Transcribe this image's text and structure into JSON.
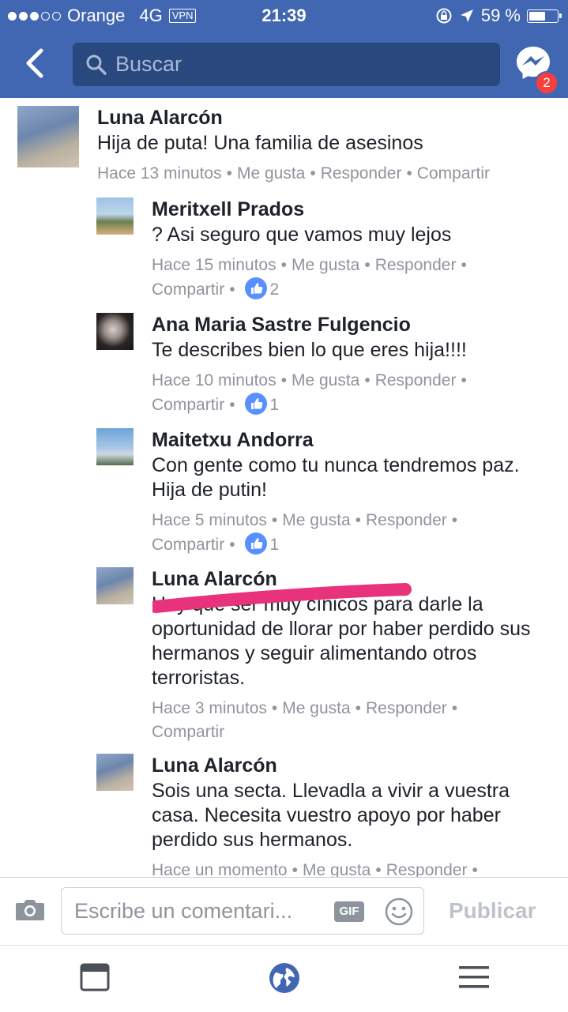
{
  "status_bar": {
    "carrier": "Orange",
    "network": "4G",
    "vpn": "VPN",
    "time": "21:39",
    "battery": "59 %",
    "battery_level": 0.59
  },
  "header": {
    "search_placeholder": "Buscar",
    "messenger_badge": "2"
  },
  "comments": [
    {
      "name": "Luna Alarcón",
      "text": "Hija de puta! Una familia de asesinos",
      "time": "Hace 13 minutos",
      "like": "Me gusta",
      "reply": "Responder",
      "share": "Compartir"
    },
    {
      "name": "Meritxell Prados",
      "text": "? Asi seguro que vamos muy lejos",
      "time": "Hace 15 minutos",
      "like": "Me gusta",
      "reply": "Responder",
      "share": "Compartir",
      "likes": "2"
    },
    {
      "name": "Ana Maria Sastre Fulgencio",
      "text": "Te describes bien lo que eres hija!!!!",
      "time": "Hace 10 minutos",
      "like": "Me gusta",
      "reply": "Responder",
      "share": "Compartir",
      "likes": "1"
    },
    {
      "name": "Maitetxu Andorra",
      "text": "Con gente como tu nunca tendremos paz. Hija de putin!",
      "time": "Hace 5 minutos",
      "like": "Me gusta",
      "reply": "Responder",
      "share": "Compartir",
      "likes": "1"
    },
    {
      "name": "Luna Alarcón",
      "text": "Hay que ser muy cínicos para darle la oportunidad de llorar por haber perdido sus hermanos y seguir alimentando otros terroristas.",
      "time": "Hace 3 minutos",
      "like": "Me gusta",
      "reply": "Responder",
      "share": "Compartir"
    },
    {
      "name": "Luna Alarcón",
      "text": "Sois una secta. Llevadla a vivir a vuestra casa. Necesita vuestro apoyo por haber perdido sus hermanos.",
      "time": "Hace un momento",
      "like": "Me gusta",
      "reply": "Responder"
    }
  ],
  "composer": {
    "placeholder": "Escribe un comentari...",
    "gif": "GIF",
    "publish": "Publicar"
  },
  "colors": {
    "brand": "#4267b2",
    "search_bg": "#29487d",
    "meta": "#90949c",
    "like": "#5890ff",
    "scribble": "#e8327c"
  }
}
